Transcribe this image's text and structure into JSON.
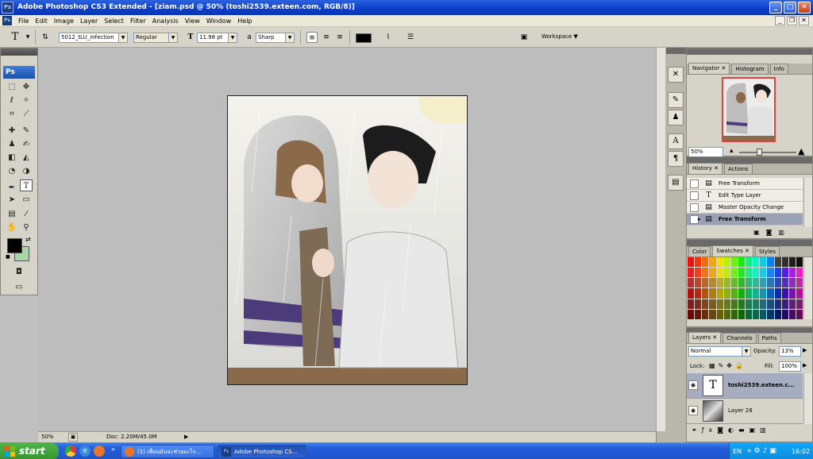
{
  "window": {
    "title": "Adobe Photoshop CS3 Extended - [ziam.psd @ 50% (toshi2539.exteen.com, RGB/8)]",
    "app_icon": "Ps"
  },
  "menu": [
    "File",
    "Edit",
    "Image",
    "Layer",
    "Select",
    "Filter",
    "Analysis",
    "View",
    "Window",
    "Help"
  ],
  "options": {
    "tool_glyph": "T",
    "font_family": "5012_tLU_infection",
    "font_style": "Regular",
    "font_size": "11.98 pt",
    "aa_label": "a",
    "antialias": "Sharp",
    "workspace_label": "Workspace",
    "text_color": "#000000"
  },
  "toolbox": {
    "logo": "Ps",
    "foreground": "#000000",
    "background": "#a9d6a4"
  },
  "status": {
    "zoom": "50%",
    "doc": "Doc: 2.20M/45.0M"
  },
  "navigator": {
    "tabs": [
      "Navigator",
      "Histogram",
      "Info"
    ],
    "zoom": "50%"
  },
  "history": {
    "tabs": [
      "History",
      "Actions"
    ],
    "items": [
      {
        "label": "Free Transform",
        "active": false
      },
      {
        "label": "Edit Type Layer",
        "active": false
      },
      {
        "label": "Master Opacity Change",
        "active": false
      },
      {
        "label": "Free Transform",
        "active": true
      }
    ]
  },
  "swatches": {
    "tabs": [
      "Color",
      "Swatches",
      "Styles"
    ]
  },
  "layers": {
    "tabs": [
      "Layers",
      "Channels",
      "Paths"
    ],
    "blend_mode": "Normal",
    "opacity_label": "Opacity:",
    "opacity": "13%",
    "lock_label": "Lock:",
    "fill_label": "Fill:",
    "fill": "100%",
    "items": [
      {
        "name": "toshi2539.exteen.c...",
        "type": "text",
        "glyph": "T",
        "active": true
      },
      {
        "name": "Layer 28",
        "type": "pixel",
        "active": false
      }
    ]
  },
  "taskbar": {
    "start": "start",
    "tasks": [
      {
        "label": "(1) เพื่อนมันจะช่วยอะไร...",
        "active": false
      },
      {
        "label": "Adobe Photoshop CS...",
        "active": true
      }
    ],
    "lang": "EN",
    "time": "16:02"
  }
}
